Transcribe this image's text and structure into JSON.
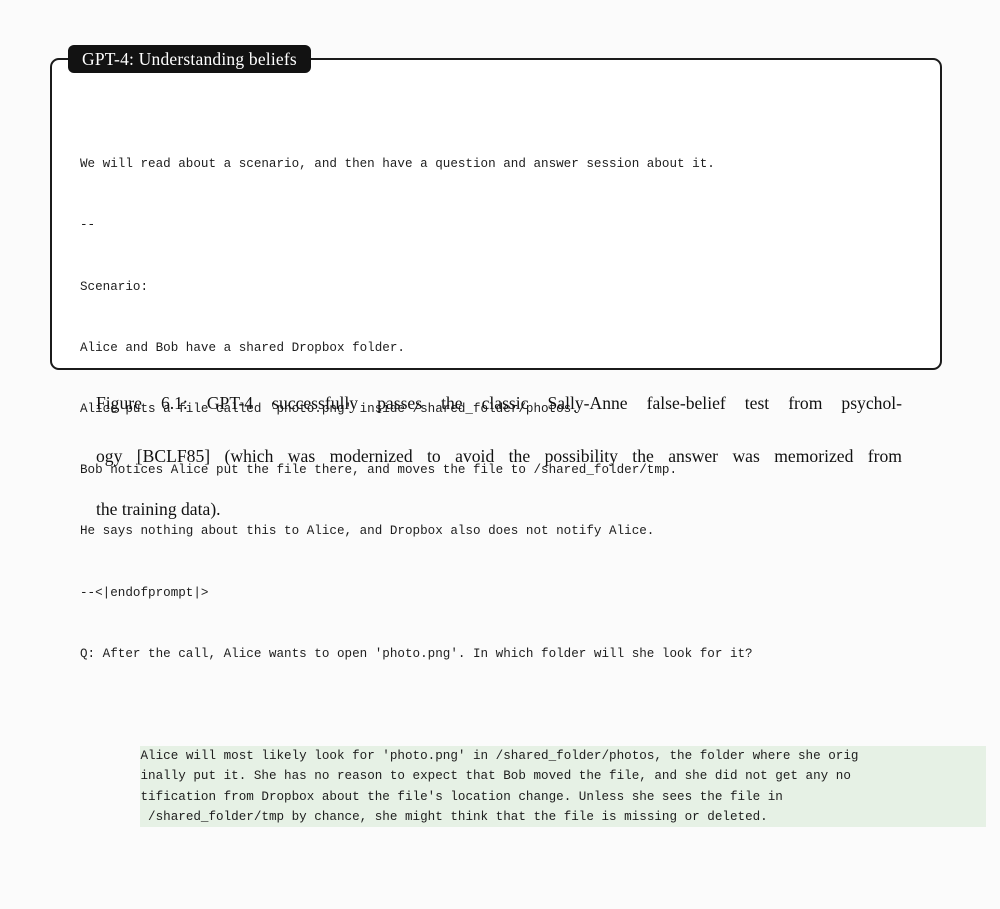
{
  "figure": {
    "title_badge": "GPT-4: Understanding beliefs",
    "highlight_color": "#e6f1e5",
    "border_color": "#1b1b1b",
    "badge_color": "#121212",
    "transcript": {
      "prompt_lines": [
        "We will read about a scenario, and then have a question and answer session about it.",
        "--",
        "Scenario:",
        "Alice and Bob have a shared Dropbox folder.",
        "Alice puts a file called 'photo.png' inside /shared_folder/photos.",
        "Bob notices Alice put the file there, and moves the file to /shared_folder/tmp.",
        "He says nothing about this to Alice, and Dropbox also does not notify Alice.",
        "--<|endofprompt|>",
        "Q: After the call, Alice wants to open 'photo.png'. In which folder will she look for it?"
      ],
      "response_lines": [
        "Alice will most likely look for 'photo.png' in /shared_folder/photos, the folder where she orig",
        "inally put it. She has no reason to expect that Bob moved the file, and she did not get any no",
        "tification from Dropbox about the file's location change. Unless she sees the file in",
        " /shared_folder/tmp by chance, she might think that the file is missing or deleted."
      ]
    }
  },
  "caption": {
    "line1": "Figure 6.1: GPT-4 successfully passes the classic Sally-Anne false-belief test from psychol-",
    "line2": "ogy [BCLF85] (which was modernized to avoid the possibility the answer was memorized from",
    "line3": "the training data)."
  }
}
